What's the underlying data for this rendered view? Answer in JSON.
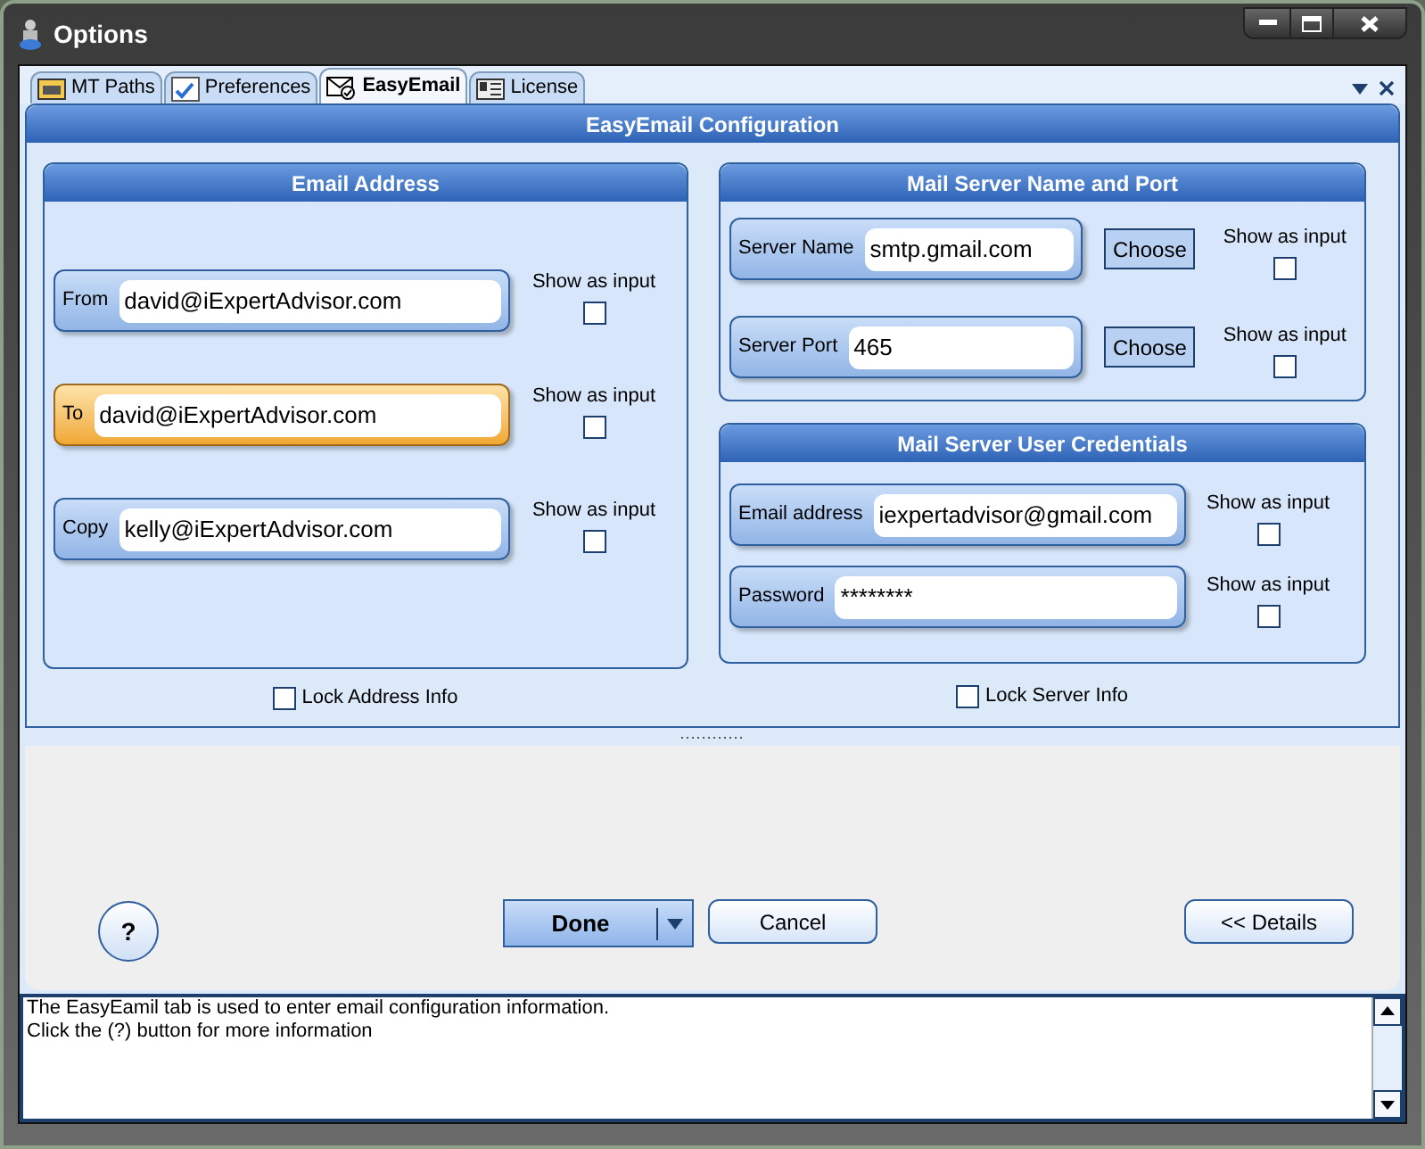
{
  "window": {
    "title": "Options"
  },
  "tabs": [
    {
      "label": "MT Paths",
      "selected": false
    },
    {
      "label": "Preferences",
      "selected": false
    },
    {
      "label": "EasyEmail",
      "selected": true
    },
    {
      "label": "License",
      "selected": false
    }
  ],
  "header": "EasyEmail Configuration",
  "email_address": {
    "title": "Email Address",
    "fields": [
      {
        "label": "From",
        "value": "david@iExpertAdvisor.com",
        "focused": false,
        "option_label": "Show as input",
        "option_checked": false
      },
      {
        "label": "To",
        "value": "david@iExpertAdvisor.com",
        "focused": true,
        "option_label": "Show as input",
        "option_checked": false
      },
      {
        "label": "Copy",
        "value": "kelly@iExpertAdvisor.com",
        "focused": false,
        "option_label": "Show as input",
        "option_checked": false
      }
    ]
  },
  "lock_address": {
    "label": "Lock Address Info",
    "checked": false
  },
  "mail_server": {
    "title": "Mail Server Name and Port",
    "fields": [
      {
        "label": "Server Name",
        "value": "smtp.gmail.com",
        "focused": false,
        "button": "Choose",
        "option_label": "Show as input",
        "option_checked": false
      },
      {
        "label": "Server Port",
        "value": "465",
        "focused": false,
        "button": "Choose",
        "option_label": "Show as input",
        "option_checked": false
      }
    ]
  },
  "credentials": {
    "title": "Mail Server User Credentials",
    "fields": [
      {
        "label": "Email address",
        "value": "iexpertadvisor@gmail.com",
        "focused": false,
        "option_label": "Show as input",
        "option_checked": false
      },
      {
        "label": "Password",
        "value": "********",
        "focused": false,
        "option_label": "Show as input",
        "option_checked": false
      }
    ]
  },
  "lock_server": {
    "label": "Lock Server Info",
    "checked": false
  },
  "buttons": {
    "help": "?",
    "done": "Done",
    "cancel": "Cancel",
    "details": "<< Details"
  },
  "message": [
    "The EasyEamil tab is used to enter email configuration information.",
    "Click the (?) button for more information"
  ]
}
